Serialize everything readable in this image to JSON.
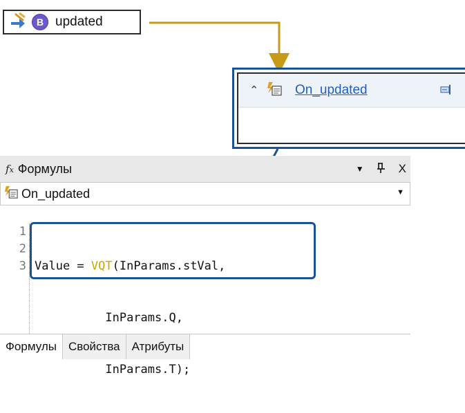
{
  "signal_node": {
    "label": "updated",
    "badge": "B",
    "icon": "signal-arrow-icon"
  },
  "handler_card": {
    "title": "On_updated",
    "icon": "script-handler-icon",
    "param_icon": "parameter-icon"
  },
  "formulas_panel": {
    "title": "Формулы",
    "selector_value": "On_updated",
    "line_numbers": [
      "1",
      "2",
      "3"
    ],
    "code_lines": [
      {
        "pre": "Value = ",
        "kw": "VQT",
        "post": "(InParams.stVal,"
      },
      {
        "pre": "          ",
        "kw": "",
        "post": "InParams.Q,"
      },
      {
        "pre": "          ",
        "kw": "",
        "post": "InParams.T);"
      }
    ],
    "tabs": [
      "Формулы",
      "Свойства",
      "Атрибуты"
    ],
    "controls": {
      "dropdown": "▼",
      "pin": "ꟼ",
      "close": "X"
    }
  },
  "colors": {
    "arrow_gold": "#c89a1a",
    "arrow_blue": "#1a5391",
    "highlight_box": "#1a5391",
    "keyword": "#c8a800"
  }
}
